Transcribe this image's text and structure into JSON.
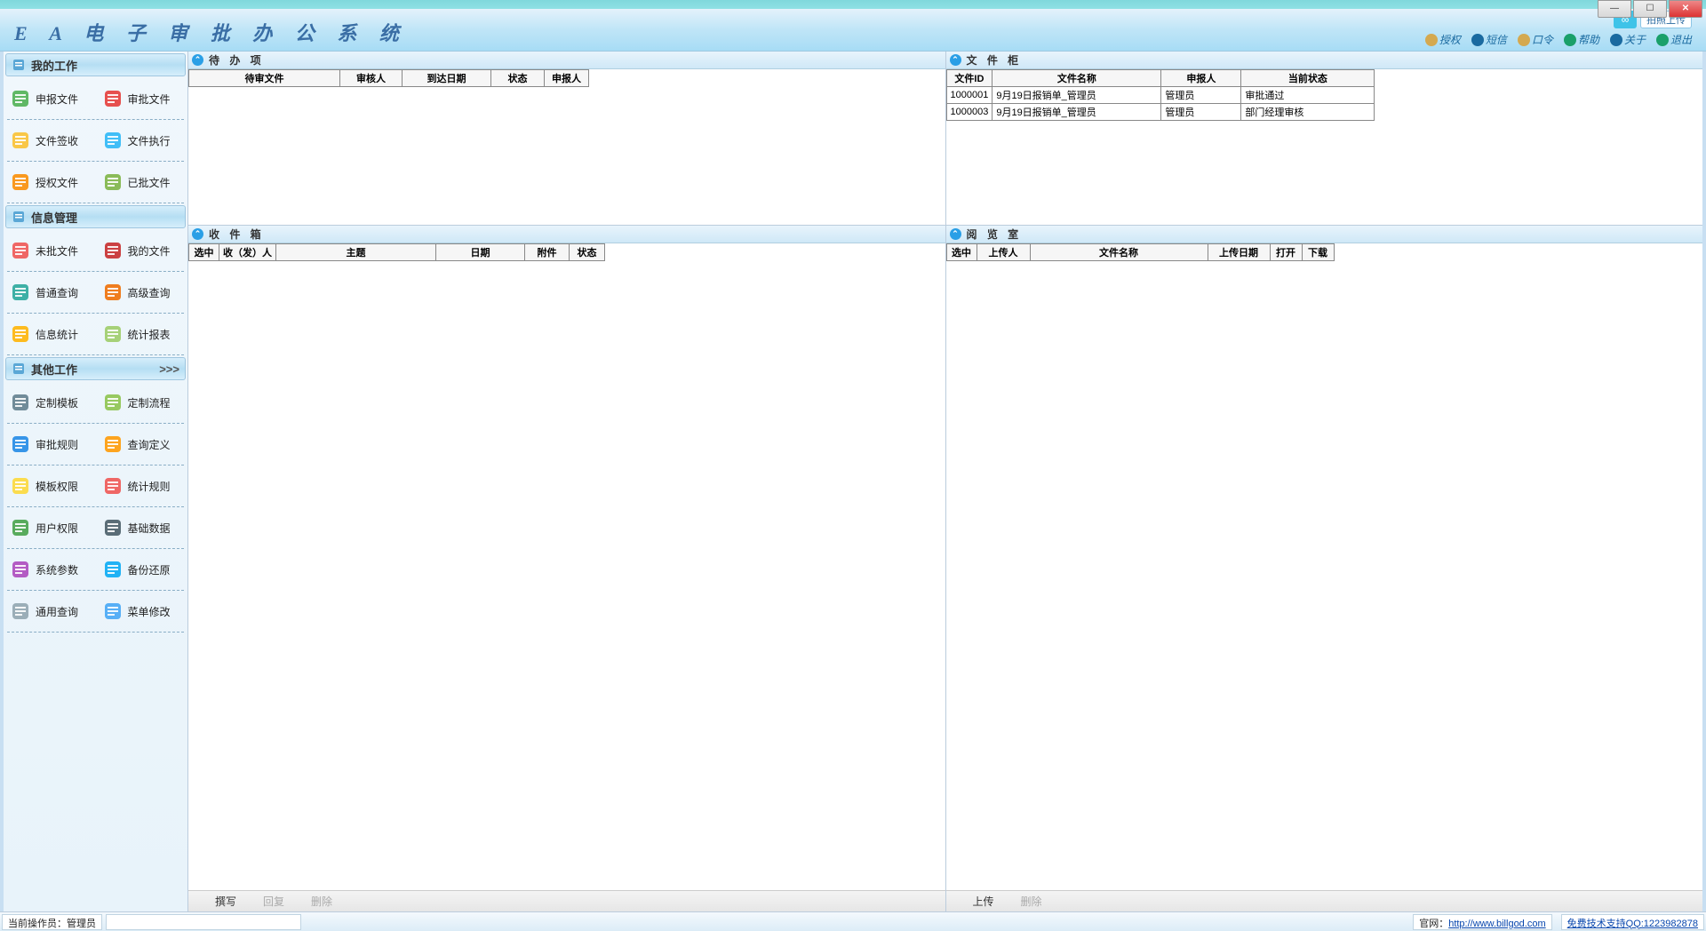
{
  "app_title": "E A 电 子 审 批 办 公 系 统",
  "header": {
    "upload_btn": "拍照上传",
    "links": [
      "授权",
      "短信",
      "口令",
      "帮助",
      "关于",
      "退出"
    ]
  },
  "sidebar": {
    "sections": [
      {
        "title": "我的工作",
        "more": "",
        "items": [
          "申报文件",
          "审批文件",
          "文件签收",
          "文件执行",
          "授权文件",
          "已批文件"
        ]
      },
      {
        "title": "信息管理",
        "more": "",
        "items": [
          "未批文件",
          "我的文件",
          "普通查询",
          "高级查询",
          "信息统计",
          "统计报表"
        ]
      },
      {
        "title": "其他工作",
        "more": ">>>",
        "items": [
          "定制模板",
          "定制流程",
          "审批规则",
          "查询定义",
          "模板权限",
          "统计规则",
          "用户权限",
          "基础数据",
          "系统参数",
          "备份还原",
          "通用查询",
          "菜单修改"
        ]
      }
    ]
  },
  "panes": {
    "todo": {
      "title": "待 办 项",
      "cols": [
        "待审文件",
        "审核人",
        "到达日期",
        "状态",
        "申报人"
      ],
      "widths": [
        170,
        70,
        100,
        60,
        50
      ],
      "rows": []
    },
    "cabinet": {
      "title": "文 件 柜",
      "cols": [
        "文件ID",
        "文件名称",
        "申报人",
        "当前状态"
      ],
      "widths": [
        50,
        190,
        90,
        150
      ],
      "rows": [
        [
          "1000001",
          "9月19日报销单_管理员",
          "管理员",
          "审批通过"
        ],
        [
          "1000003",
          "9月19日报销单_管理员",
          "管理员",
          "部门经理审核"
        ]
      ]
    },
    "inbox": {
      "title": "收 件 箱",
      "cols": [
        "选中",
        "收（发）人",
        "主题",
        "日期",
        "附件",
        "状态"
      ],
      "widths": [
        34,
        64,
        180,
        100,
        50,
        40
      ],
      "toolbar": [
        {
          "t": "撰写",
          "on": true
        },
        {
          "t": "回复",
          "on": false
        },
        {
          "t": "删除",
          "on": false
        }
      ]
    },
    "reading": {
      "title": "阅 览 室",
      "cols": [
        "选中",
        "上传人",
        "文件名称",
        "上传日期",
        "打开",
        "下载"
      ],
      "widths": [
        34,
        60,
        200,
        70,
        36,
        36
      ],
      "toolbar": [
        {
          "t": "上传",
          "on": true
        },
        {
          "t": "删除",
          "on": false
        }
      ]
    }
  },
  "status": {
    "operator_label": "当前操作员：",
    "operator": "管理员",
    "site_label": "官网：",
    "site_url": "http://www.billgod.com",
    "support": "免费技术支持QQ:1223982878"
  },
  "icon_colors": {
    "申报文件": "#4caf50",
    "审批文件": "#e53935",
    "文件签收": "#fbc02d",
    "文件执行": "#29b6f6",
    "授权文件": "#fb8c00",
    "已批文件": "#7cb342",
    "未批文件": "#ef5350",
    "我的文件": "#c62828",
    "普通查询": "#26a69a",
    "高级查询": "#ef6c00",
    "信息统计": "#ffb300",
    "统计报表": "#9ccc65",
    "定制模板": "#607d8b",
    "定制流程": "#8bc34a",
    "审批规则": "#1e88e5",
    "查询定义": "#ff9800",
    "模板权限": "#fdd835",
    "统计规则": "#ef5350",
    "用户权限": "#43a047",
    "基础数据": "#455a64",
    "系统参数": "#ab47bc",
    "备份还原": "#03a9f4",
    "通用查询": "#90a4ae",
    "菜单修改": "#42a5f5"
  }
}
